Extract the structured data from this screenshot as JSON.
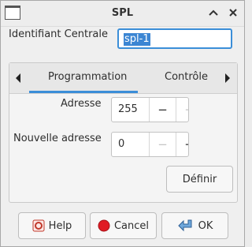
{
  "window": {
    "title": "SPL"
  },
  "header": {
    "id_label": "Identifiant Centrale",
    "id_value": "spl-1"
  },
  "tabs": {
    "items": [
      {
        "label": "Programmation",
        "active": true
      },
      {
        "label": "Contrôle",
        "active": false
      }
    ]
  },
  "fields": {
    "adresse": {
      "label": "Adresse",
      "value": "255",
      "minus": "−",
      "plus": "+"
    },
    "nouvelle_adresse": {
      "label": "Nouvelle adresse",
      "value": "0",
      "minus": "−",
      "plus": "+"
    }
  },
  "actions": {
    "definir_label": "Définir"
  },
  "footer": {
    "help_label": "Help",
    "cancel_label": "Cancel",
    "ok_label": "OK"
  },
  "colors": {
    "accent": "#3b8ed8",
    "selection": "#3c86d3",
    "cancel_red": "#e01b24"
  }
}
